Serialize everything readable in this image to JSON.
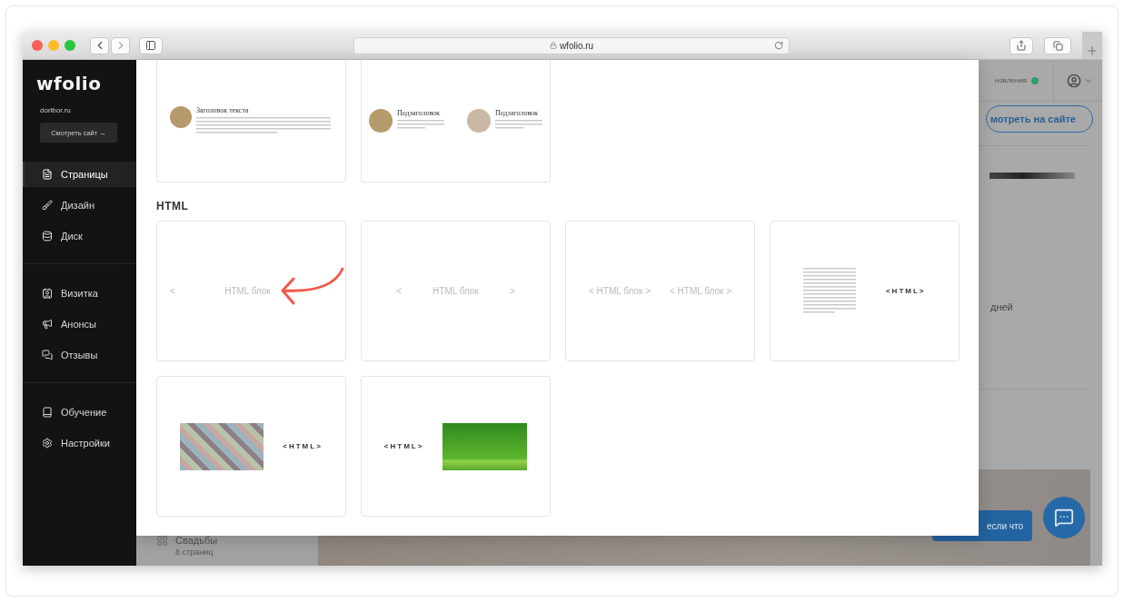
{
  "browser": {
    "url": "wfolio.ru"
  },
  "sidebar": {
    "logo": "wfolio",
    "domain": "doribor.ru",
    "view_site_button": "Смотреть сайт →",
    "groups": [
      {
        "items": [
          {
            "label": "Страницы",
            "selected": true
          },
          {
            "label": "Дизайн",
            "selected": false
          },
          {
            "label": "Диск",
            "selected": false
          }
        ]
      },
      {
        "items": [
          {
            "label": "Визитка",
            "selected": false
          },
          {
            "label": "Анонсы",
            "selected": false
          },
          {
            "label": "Отзывы",
            "selected": false
          }
        ]
      },
      {
        "items": [
          {
            "label": "Обучение",
            "selected": false
          },
          {
            "label": "Настройки",
            "selected": false
          }
        ]
      }
    ]
  },
  "background": {
    "status": "новления",
    "view_button": "мотреть на сайте",
    "text_fragment": "дней",
    "help_button": "если что",
    "album": {
      "title": "Свадьбы",
      "subtitle": "8 страниц"
    }
  },
  "modal": {
    "top_cards": [
      {
        "kind": "single",
        "items": [
          {
            "title": "Заголовок текста"
          }
        ]
      },
      {
        "kind": "double",
        "items": [
          {
            "title": "Подзаголовок"
          },
          {
            "title": "Подзаголовок"
          }
        ]
      }
    ],
    "section_title": "HTML",
    "cards": [
      {
        "annotated": true,
        "elements": [
          {
            "kind": "muted",
            "text": "<"
          },
          {
            "kind": "muted",
            "text": "HTML блок"
          }
        ]
      },
      {
        "annotated": false,
        "elements": [
          {
            "kind": "muted",
            "text": "<"
          },
          {
            "kind": "muted",
            "text": "HTML блок"
          },
          {
            "kind": "muted",
            "text": ">"
          }
        ]
      },
      {
        "annotated": false,
        "elements": [
          {
            "kind": "muted",
            "text": "< HTML блок >"
          },
          {
            "kind": "muted",
            "text": "< HTML блок >"
          }
        ]
      },
      {
        "annotated": false,
        "elements": [
          {
            "kind": "lines"
          },
          {
            "kind": "tag",
            "text": "<HTML>"
          }
        ]
      },
      {
        "annotated": false,
        "elements": [
          {
            "kind": "mosaic"
          },
          {
            "kind": "tag",
            "text": "<HTML>"
          }
        ]
      },
      {
        "annotated": false,
        "elements": [
          {
            "kind": "tag",
            "text": "<HTML>"
          },
          {
            "kind": "green"
          }
        ]
      }
    ]
  }
}
